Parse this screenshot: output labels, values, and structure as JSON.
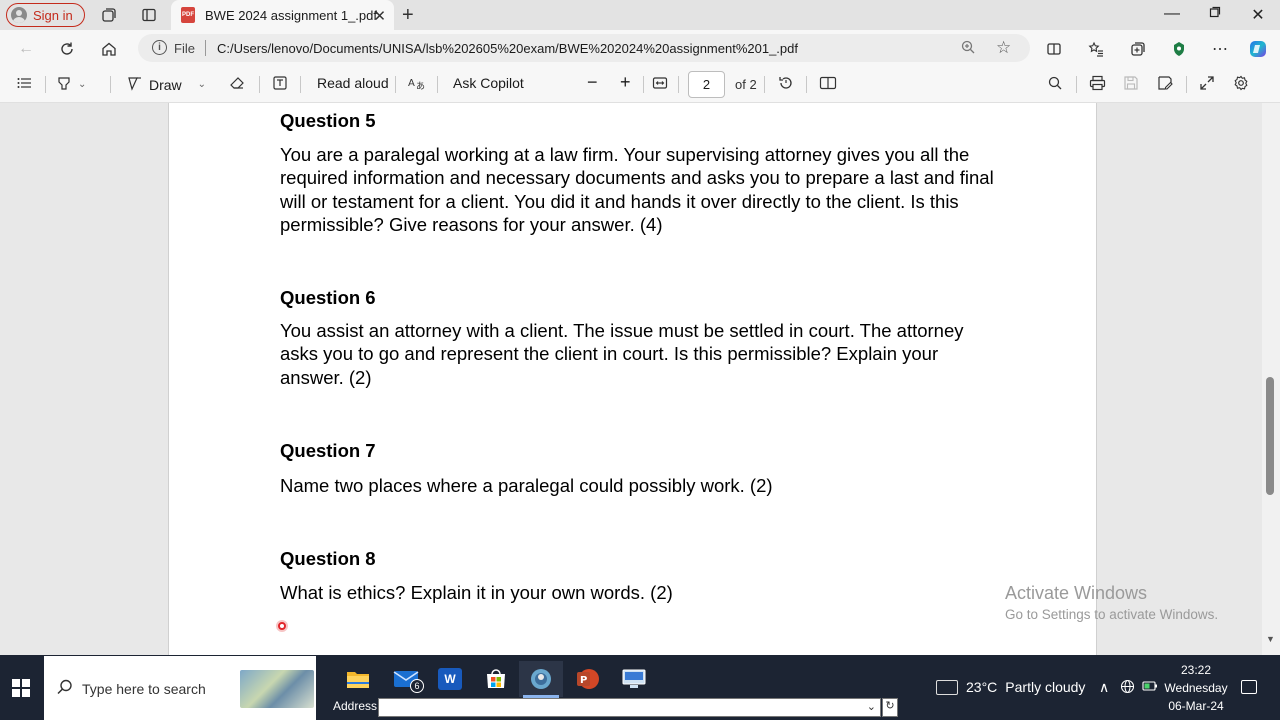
{
  "browser": {
    "sign_in": "Sign in",
    "tab_title": "BWE 2024 assignment 1_.pdf",
    "pdf_badge": "PDF",
    "file_label": "File",
    "url": "C:/Users/lenovo/Documents/UNISA/lsb%202605%20exam/BWE%202024%20assignment%201_.pdf"
  },
  "pdf_toolbar": {
    "draw_label": "Draw",
    "read_aloud_label": "Read aloud",
    "ask_copilot_label": "Ask Copilot",
    "page_current": "2",
    "page_total": "of 2"
  },
  "document": {
    "questions": [
      {
        "title": "Question 5",
        "body": "You are a paralegal working at a law firm. Your supervising attorney gives you all the required information and necessary documents and asks you to prepare a last and final will or testament for a client. You did it and hands it over directly to the client. Is this permissible? Give reasons for your answer. (4)"
      },
      {
        "title": "Question 6",
        "body": "You assist an attorney with a client. The issue must be settled in court. The attorney asks you to go and represent the client in court. Is this permissible? Explain your answer. (2)"
      },
      {
        "title": "Question 7",
        "body": "Name two places where a paralegal could possibly work. (2)"
      },
      {
        "title": "Question 8",
        "body": "What is ethics? Explain it in your own words. (2)"
      }
    ]
  },
  "watermark": {
    "line1": "Activate Windows",
    "line2": "Go to Settings to activate Windows."
  },
  "taskbar": {
    "search_placeholder": "Type here to search",
    "mail_badge": "6",
    "address_label": "Address",
    "weather_temp": "23°C",
    "weather_desc": "Partly cloudy",
    "time": "23:22",
    "day": "Wednesday",
    "date": "06-Mar-24"
  },
  "colors": {
    "signin_red": "#c42b1c",
    "taskbar_bg": "#1c2433",
    "pdf_red": "#d6453d"
  }
}
